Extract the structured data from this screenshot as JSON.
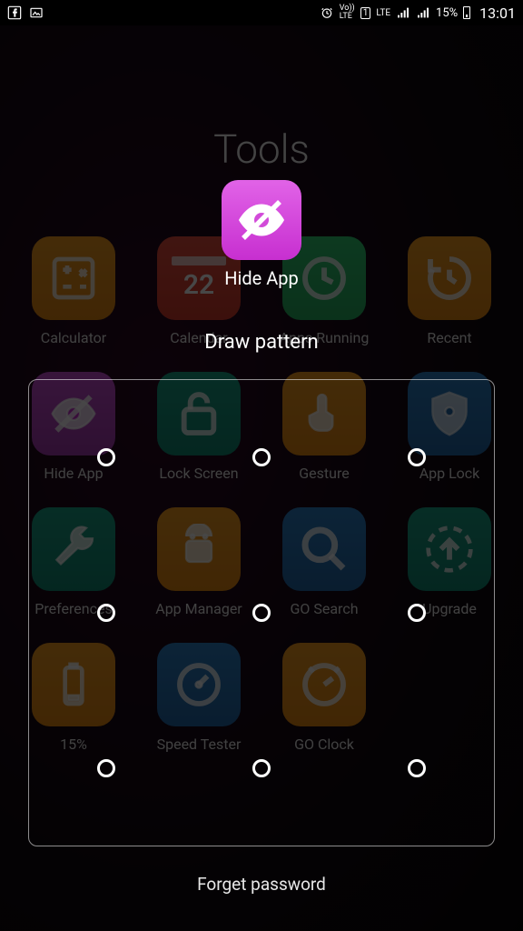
{
  "statusbar": {
    "sim_label": "1",
    "net_label": "LTE",
    "volte_label": "Vo))\nLTE",
    "battery_pct": "15%",
    "time": "13:01"
  },
  "background": {
    "folder_title": "Tools",
    "apps": [
      {
        "label": "Calculator",
        "color": "ic-orange",
        "icon": "calc"
      },
      {
        "label": "Calendar",
        "color": "ic-red",
        "icon": "cal",
        "day": "22"
      },
      {
        "label": "Apps Running",
        "color": "ic-green",
        "icon": "clock"
      },
      {
        "label": "Recent",
        "color": "ic-orange",
        "icon": "recent"
      },
      {
        "label": "Hide App",
        "color": "ic-purple",
        "icon": "eye"
      },
      {
        "label": "Lock Screen",
        "color": "ic-teal",
        "icon": "lock"
      },
      {
        "label": "Gesture",
        "color": "ic-orange",
        "icon": "hand"
      },
      {
        "label": "App Lock",
        "color": "ic-blue",
        "icon": "shield"
      },
      {
        "label": "Preferences",
        "color": "ic-teal",
        "icon": "wrench"
      },
      {
        "label": "App Manager",
        "color": "ic-orange",
        "icon": "android"
      },
      {
        "label": "GO Search",
        "color": "ic-blue",
        "icon": "search"
      },
      {
        "label": "Upgrade",
        "color": "ic-teal",
        "icon": "upgrade"
      },
      {
        "label": "15%",
        "color": "ic-orange",
        "icon": "battery"
      },
      {
        "label": "Speed Tester",
        "color": "ic-blue",
        "icon": "gauge"
      },
      {
        "label": "GO Clock",
        "color": "ic-orange",
        "icon": "goclock"
      }
    ]
  },
  "lock": {
    "app_name": "Hide App",
    "instruction": "Draw pattern",
    "forget_label": "Forget password"
  }
}
